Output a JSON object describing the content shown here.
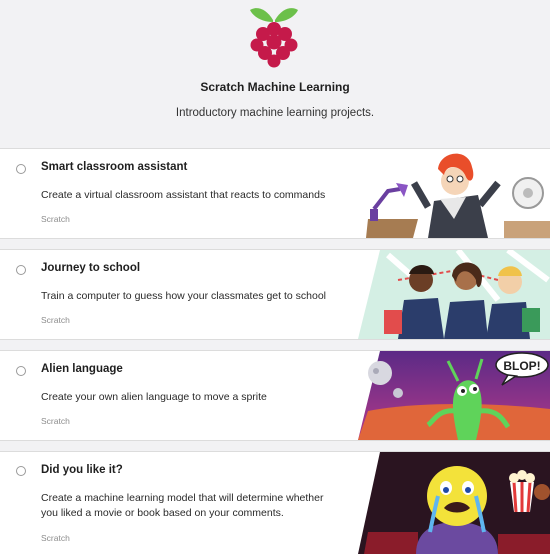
{
  "header": {
    "logo_icon": "raspberry-pi-logo",
    "title": "Scratch Machine Learning",
    "subtitle": "Introductory machine learning projects."
  },
  "projects": [
    {
      "title": "Smart classroom assistant",
      "description": "Create a virtual classroom assistant that reacts to commands",
      "tag": "Scratch",
      "thumbnail_icon": "classroom-assistant-illustration"
    },
    {
      "title": "Journey to school",
      "description": "Train a computer to guess how your classmates get to school",
      "tag": "Scratch",
      "thumbnail_icon": "students-map-illustration"
    },
    {
      "title": "Alien language",
      "description": "Create your own alien language to move a sprite",
      "tag": "Scratch",
      "thumbnail_icon": "alien-planet-illustration",
      "thumbnail_text": "BLOP!"
    },
    {
      "title": "Did you like it?",
      "description": "Create a machine learning model that will determine whether you liked a movie or book based on your comments.",
      "tag": "Scratch",
      "thumbnail_icon": "cinema-crying-character-illustration"
    }
  ],
  "colors": {
    "background": "#f2f2f4",
    "card": "#ffffff",
    "raspberry": "#c51a4a",
    "leaf": "#6cc04a"
  }
}
